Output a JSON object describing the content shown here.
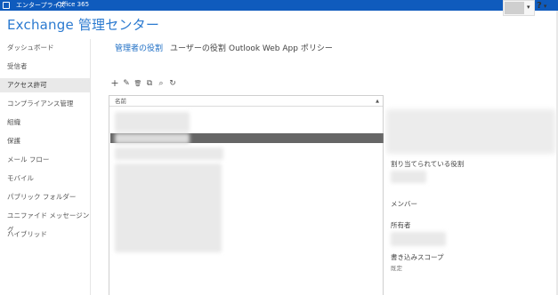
{
  "topbar": {
    "product": "エンタープライズ",
    "suite": "Office 365",
    "caret": "▾",
    "help": "?",
    "help_caret": "▾"
  },
  "app": {
    "title": "Exchange 管理センター"
  },
  "nav": {
    "items": [
      "ダッシュボード",
      "受信者",
      "アクセス許可",
      "コンプライアンス管理",
      "組織",
      "保護",
      "メール フロー",
      "モバイル",
      "パブリック フォルダー",
      "ユニファイド メッセージング",
      "ハイブリッド"
    ],
    "active_index": 2
  },
  "tabs": {
    "admin_roles": "管理者の役割",
    "user_roles": "ユーザーの役割",
    "owa_policies": "Outlook Web App ポリシー"
  },
  "toolbar": {
    "add": "+",
    "edit": "✎",
    "delete": "🗑",
    "copy": "⧉",
    "search": "⌕",
    "refresh": "↻"
  },
  "list": {
    "column_name": "名前",
    "sort_indicator": "▲"
  },
  "details": {
    "assigned_roles_label": "割り当てられている役割",
    "members_label": "メンバー",
    "owner_label": "所有者",
    "write_scope_label": "書き込みスコープ",
    "write_scope_value": "既定"
  }
}
